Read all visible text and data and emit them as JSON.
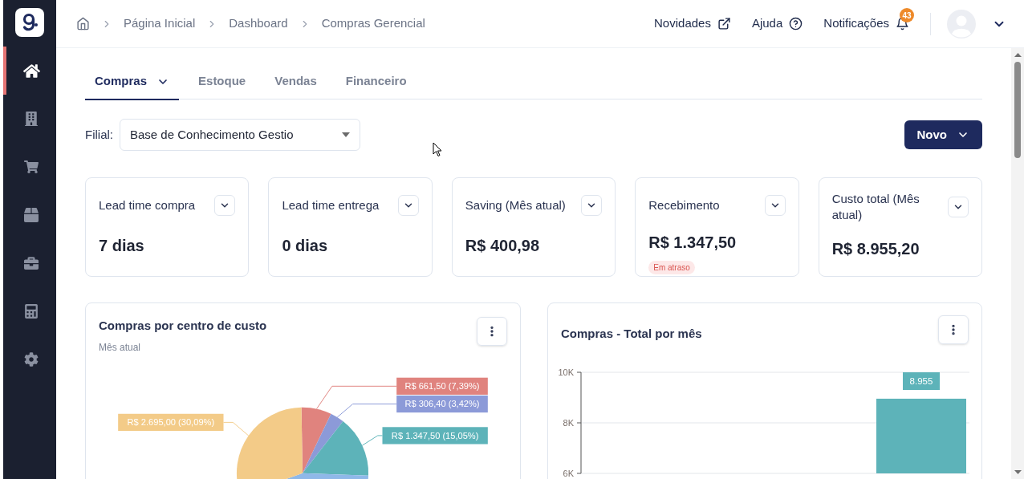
{
  "sidebar": {
    "items": [
      {
        "kind": "home",
        "selected": true
      },
      {
        "kind": "building",
        "selected": false
      },
      {
        "kind": "cart",
        "selected": false
      },
      {
        "kind": "box",
        "selected": false
      },
      {
        "kind": "briefcase",
        "selected": false
      },
      {
        "kind": "calculator",
        "selected": false
      },
      {
        "kind": "gear",
        "selected": false
      }
    ]
  },
  "breadcrumb": [
    "Página Inicial",
    "Dashboard",
    "Compras Gerencial"
  ],
  "header_links": [
    {
      "label": "Novidades",
      "kind": "external"
    },
    {
      "label": "Ajuda",
      "kind": "help"
    },
    {
      "label": "Notificações",
      "kind": "bell",
      "badge": "43"
    }
  ],
  "tabs": [
    {
      "label": "Compras",
      "selected": true,
      "dropdown": true
    },
    {
      "label": "Estoque",
      "selected": false,
      "dropdown": false
    },
    {
      "label": "Vendas",
      "selected": false,
      "dropdown": false
    },
    {
      "label": "Financeiro",
      "selected": false,
      "dropdown": false
    }
  ],
  "filter": {
    "label": "Filial:",
    "value": "Base de Conhecimento Gestio"
  },
  "new_button": "Novo",
  "kpis": [
    {
      "title": "Lead time compra",
      "value": "7 dias"
    },
    {
      "title": "Lead time entrega",
      "value": "0 dias"
    },
    {
      "title": "Saving (Mês atual)",
      "value": "R$ 400,98"
    },
    {
      "title": "Recebimento",
      "value": "R$ 1.347,50",
      "badge": "Em atraso"
    },
    {
      "title": "Custo total (Mês atual)",
      "value": "R$ 8.955,20"
    }
  ],
  "charts": [
    {
      "title": "Compras por centro de custo",
      "subtitle": "Mês atual",
      "chart_data": {
        "type": "pie",
        "series": [
          {
            "values": [
              7.39,
              3.42,
              15.05,
              44.05,
              30.09
            ]
          }
        ],
        "colors": [
          "#e0837e",
          "#8c9ad8",
          "#5db3b9",
          "#8fb8e8",
          "#f3cb88"
        ],
        "value_labels": [
          "R$ 661,50 (7,39%)",
          "R$ 306,40 (3,42%)",
          "R$ 1.347,50 (15,05%)",
          null,
          "R$ 2.695,00 (30,09%)"
        ]
      }
    },
    {
      "title": "Compras - Total por mês",
      "chart_data": {
        "type": "bar",
        "series": [
          {
            "color": "#5db3b9",
            "values": [
              8955
            ]
          }
        ],
        "ylim": [
          6000,
          10000
        ],
        "yticks": [
          {
            "value": 6000,
            "label": "6K"
          },
          {
            "value": 8000,
            "label": "8K"
          },
          {
            "value": 10000,
            "label": "10K"
          }
        ],
        "value_labels": [
          "8.955"
        ]
      }
    }
  ]
}
